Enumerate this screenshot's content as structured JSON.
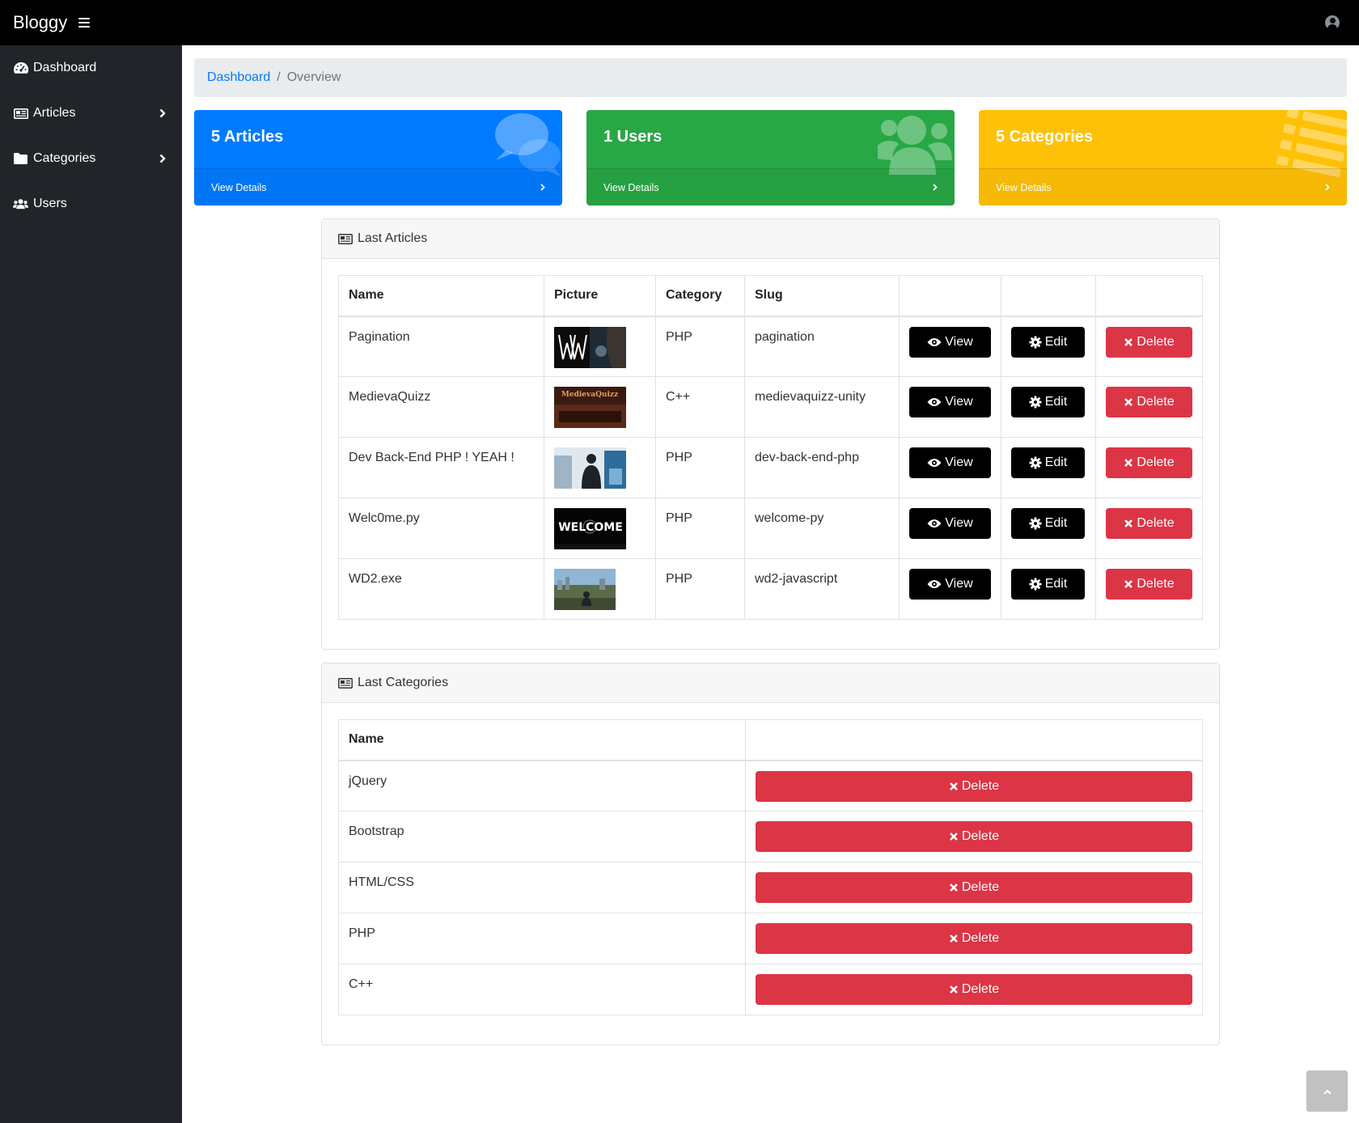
{
  "navbar": {
    "brand": "Bloggy"
  },
  "sidebar": {
    "items": [
      {
        "label": "Dashboard"
      },
      {
        "label": "Articles"
      },
      {
        "label": "Categories"
      },
      {
        "label": "Users"
      }
    ]
  },
  "breadcrumb": {
    "home": "Dashboard",
    "current": "Overview"
  },
  "cards": [
    {
      "title": "5 Articles",
      "footer": "View Details",
      "color": "#007bff"
    },
    {
      "title": "1 Users",
      "footer": "View Details",
      "color": "#28a745"
    },
    {
      "title": "5 Categories",
      "footer": "View Details",
      "color": "#ffc107"
    }
  ],
  "articles": {
    "title": "Last Articles",
    "headers": [
      "Name",
      "Picture",
      "Category",
      "Slug"
    ],
    "actions": {
      "view": "View",
      "edit": "Edit",
      "delete": "Delete"
    },
    "rows": [
      {
        "name": "Pagination",
        "category": "PHP",
        "slug": "pagination"
      },
      {
        "name": "MedievaQuizz",
        "category": "C++",
        "slug": "medievaquizz-unity"
      },
      {
        "name": "Dev Back-End PHP ! YEAH !",
        "category": "PHP",
        "slug": "dev-back-end-php"
      },
      {
        "name": "Welc0me.py",
        "category": "PHP",
        "slug": "welcome-py"
      },
      {
        "name": "WD2.exe",
        "category": "PHP",
        "slug": "wd2-javascript"
      }
    ],
    "thumb_text": {
      "medieva": "MedievaQuizz",
      "welcome": "WELCOME"
    }
  },
  "categories": {
    "title": "Last Categories",
    "headers": [
      "Name"
    ],
    "delete": "Delete",
    "rows": [
      {
        "name": "jQuery"
      },
      {
        "name": "Bootstrap"
      },
      {
        "name": "HTML/CSS"
      },
      {
        "name": "PHP"
      },
      {
        "name": "C++"
      }
    ]
  }
}
